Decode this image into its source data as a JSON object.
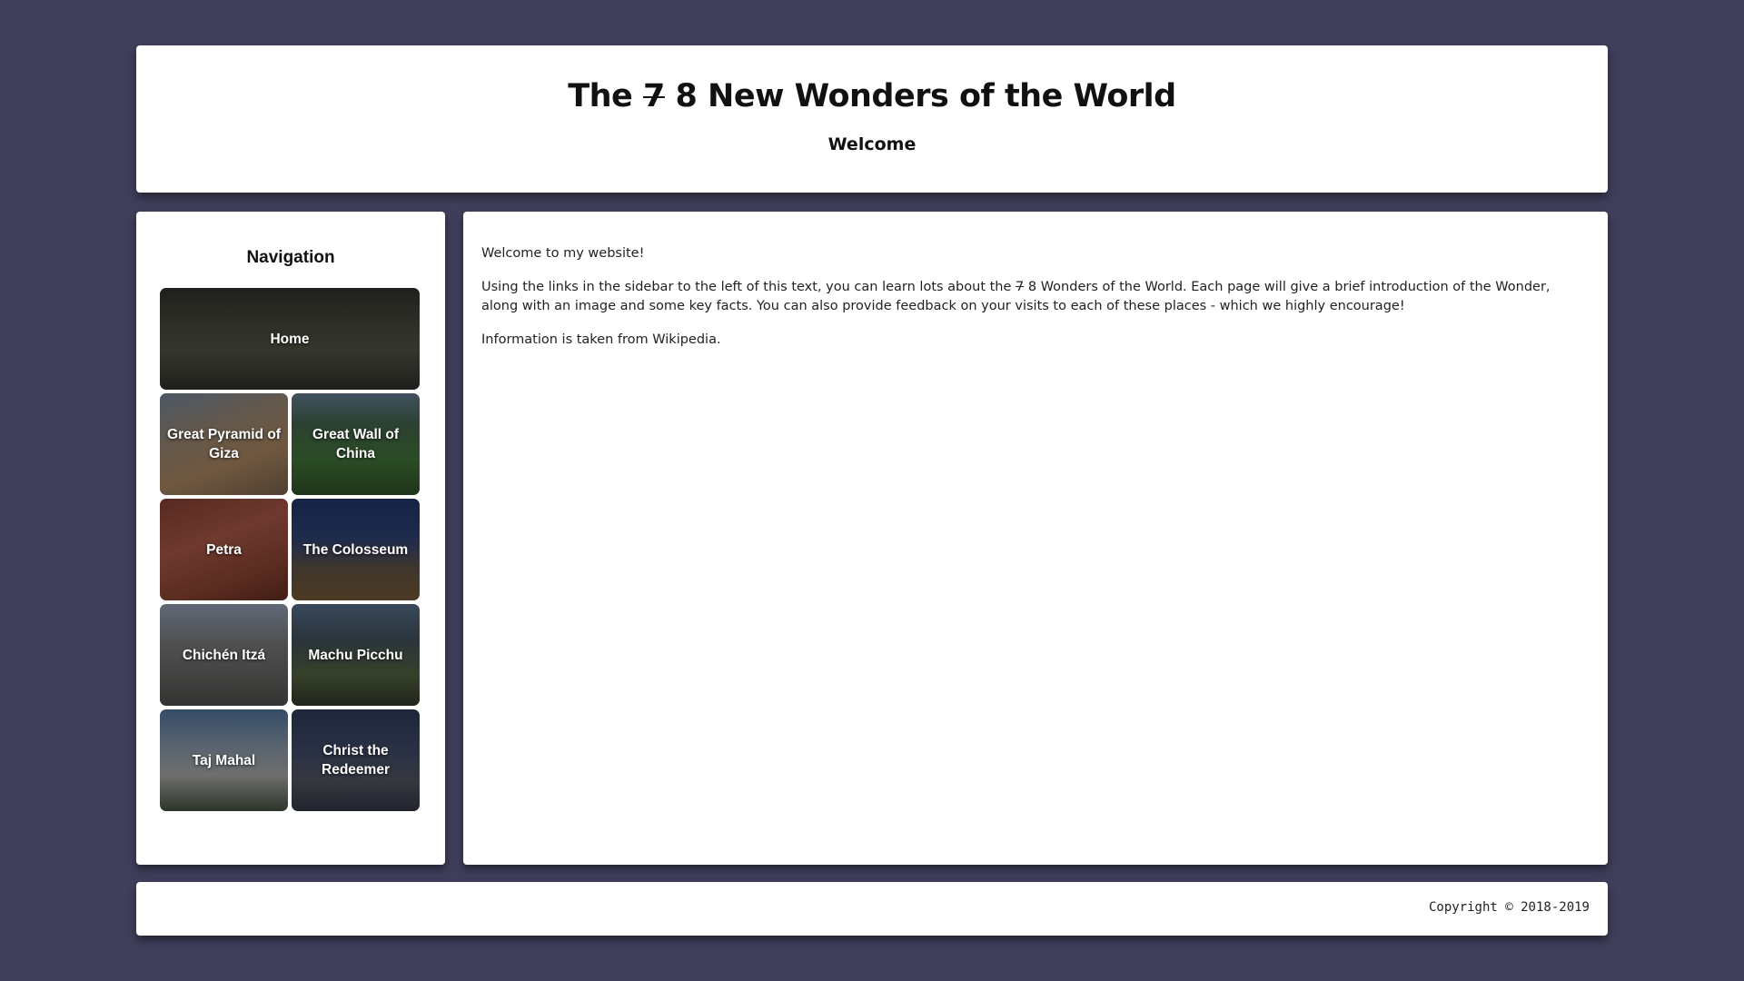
{
  "header": {
    "title_struck": "7",
    "title_rest": " 8 New Wonders of the World",
    "title_prefix": "The ",
    "subtitle": "Welcome"
  },
  "sidebar": {
    "heading": "Navigation",
    "items": [
      {
        "label": "Home",
        "bg": "linear-gradient(180deg,#2b2d28 0%,#3e4236 35%,#4a4c3f 60%,#2a2c26 100%)"
      },
      {
        "label": "Great Pyramid of Giza",
        "bg": "linear-gradient(160deg,#6a7a8e 0%,#8a7b6a 35%,#9b7a58 65%,#6e5a44 100%)"
      },
      {
        "label": "Great Wall of China",
        "bg": "linear-gradient(180deg,#5c7184 0%,#3d5a46 30%,#3c6a34 65%,#2c4a24 100%)"
      },
      {
        "label": "Petra",
        "bg": "linear-gradient(160deg,#7a3a2e 0%,#9a5040 40%,#7c3c2c 75%,#5c2a20 100%)"
      },
      {
        "label": "The Colosseum",
        "bg": "linear-gradient(180deg,#1f3060 0%,#2c3d6a 40%,#5a4c3e 70%,#6a5030 100%)"
      },
      {
        "label": "Chichén Itzá",
        "bg": "linear-gradient(180deg,#8592a6 0%,#6e6e6e 40%,#5a5a58 75%,#484846 100%)"
      },
      {
        "label": "Machu Picchu",
        "bg": "linear-gradient(180deg,#4f6680 0%,#3c4a54 35%,#4a5a3a 70%,#2e3428 100%)"
      },
      {
        "label": "Taj Mahal",
        "bg": "linear-gradient(180deg,#4a6a8e 0%,#7a8a9a 35%,#9a9a98 65%,#3e4a3a 100%)"
      },
      {
        "label": "Christ the Redeemer",
        "bg": "linear-gradient(180deg,#2a3654 0%,#3a4460 40%,#4a4e58 70%,#2e3240 100%)"
      }
    ]
  },
  "main": {
    "intro": "Welcome to my website!",
    "body_before": "Using the links in the sidebar to the left of this text, you can learn lots about the ",
    "body_struck": "7",
    "body_after": " 8 Wonders of the World. Each page will give a brief introduction of the Wonder, along with an image and some key facts. You can also provide feedback on your visits to each of these places - which we highly encourage!",
    "source": "Information is taken from Wikipedia."
  },
  "footer": {
    "copyright": "Copyright © 2018-2019"
  },
  "colors": {
    "page_background": "#3f3f5c",
    "panel_background": "#ffffff"
  }
}
